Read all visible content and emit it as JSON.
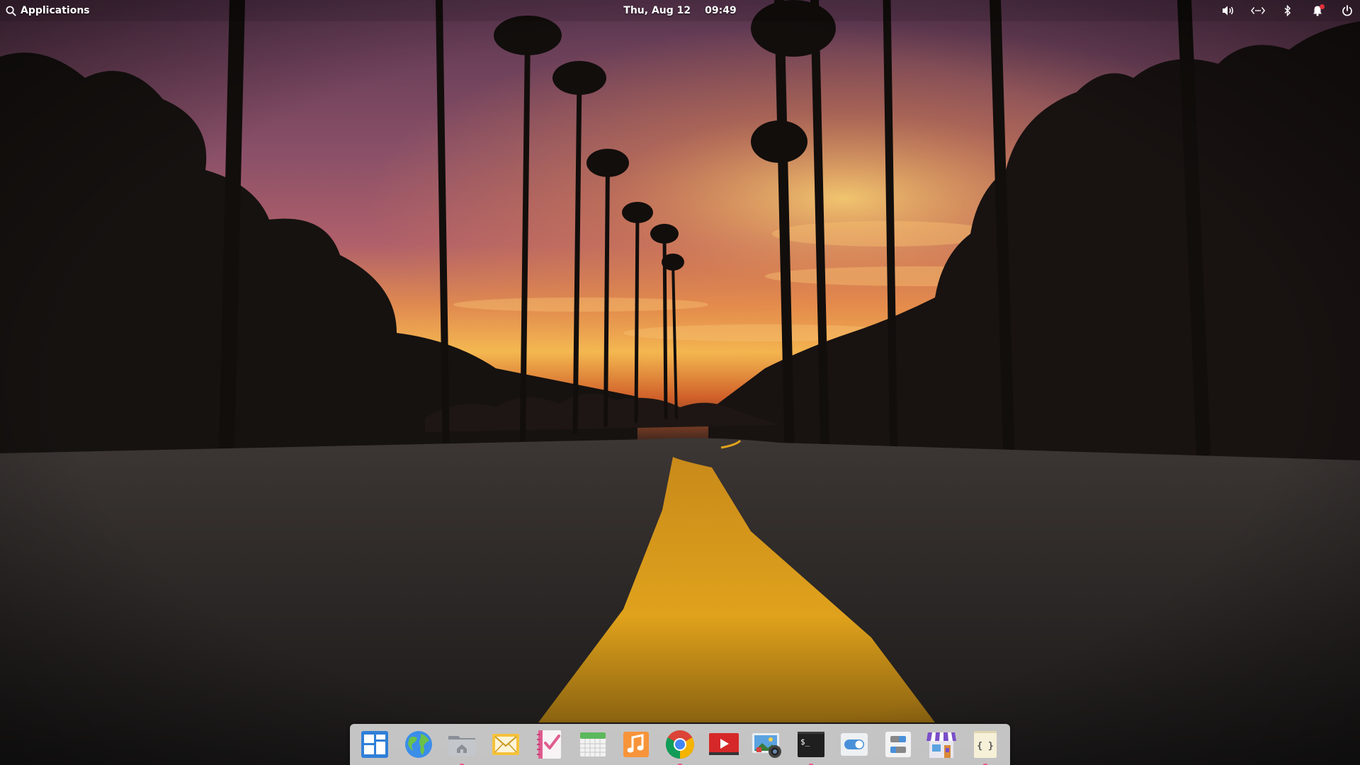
{
  "panel": {
    "applications_label": "Applications",
    "date": "Thu, Aug 12",
    "time": "09:49",
    "indicators": [
      {
        "name": "volume-icon"
      },
      {
        "name": "network-icon"
      },
      {
        "name": "bluetooth-icon"
      },
      {
        "name": "notifications-icon",
        "badge_color": "#e0303b"
      },
      {
        "name": "power-icon"
      }
    ]
  },
  "dock": {
    "items": [
      {
        "name": "multitasking-view",
        "icon": "multitasking-icon",
        "running": false
      },
      {
        "name": "web-browser",
        "icon": "globe-icon",
        "running": false
      },
      {
        "name": "files",
        "icon": "home-folder-icon",
        "running": true
      },
      {
        "name": "mail",
        "icon": "mail-icon",
        "running": false
      },
      {
        "name": "tasks",
        "icon": "tasks-icon",
        "running": false
      },
      {
        "name": "calendar",
        "icon": "calendar-icon",
        "running": false
      },
      {
        "name": "music",
        "icon": "music-icon",
        "running": false
      },
      {
        "name": "chrome",
        "icon": "chrome-icon",
        "running": true
      },
      {
        "name": "videos",
        "icon": "video-play-icon",
        "running": false
      },
      {
        "name": "photos",
        "icon": "photos-icon",
        "running": false
      },
      {
        "name": "terminal",
        "icon": "terminal-icon",
        "running": true,
        "glyph": "$_"
      },
      {
        "name": "system-settings",
        "icon": "toggle-switch-icon",
        "running": false
      },
      {
        "name": "tweaks",
        "icon": "tweaks-icon",
        "running": false
      },
      {
        "name": "appcenter",
        "icon": "store-icon",
        "running": false
      },
      {
        "name": "code",
        "icon": "braces-icon",
        "running": true,
        "glyph": "{ }"
      }
    ]
  },
  "colors": {
    "accent_running": "#e85b8a",
    "road_line": "#e0a21c",
    "sky_top": "#7a4a6a",
    "sunset": "#f0a040"
  }
}
